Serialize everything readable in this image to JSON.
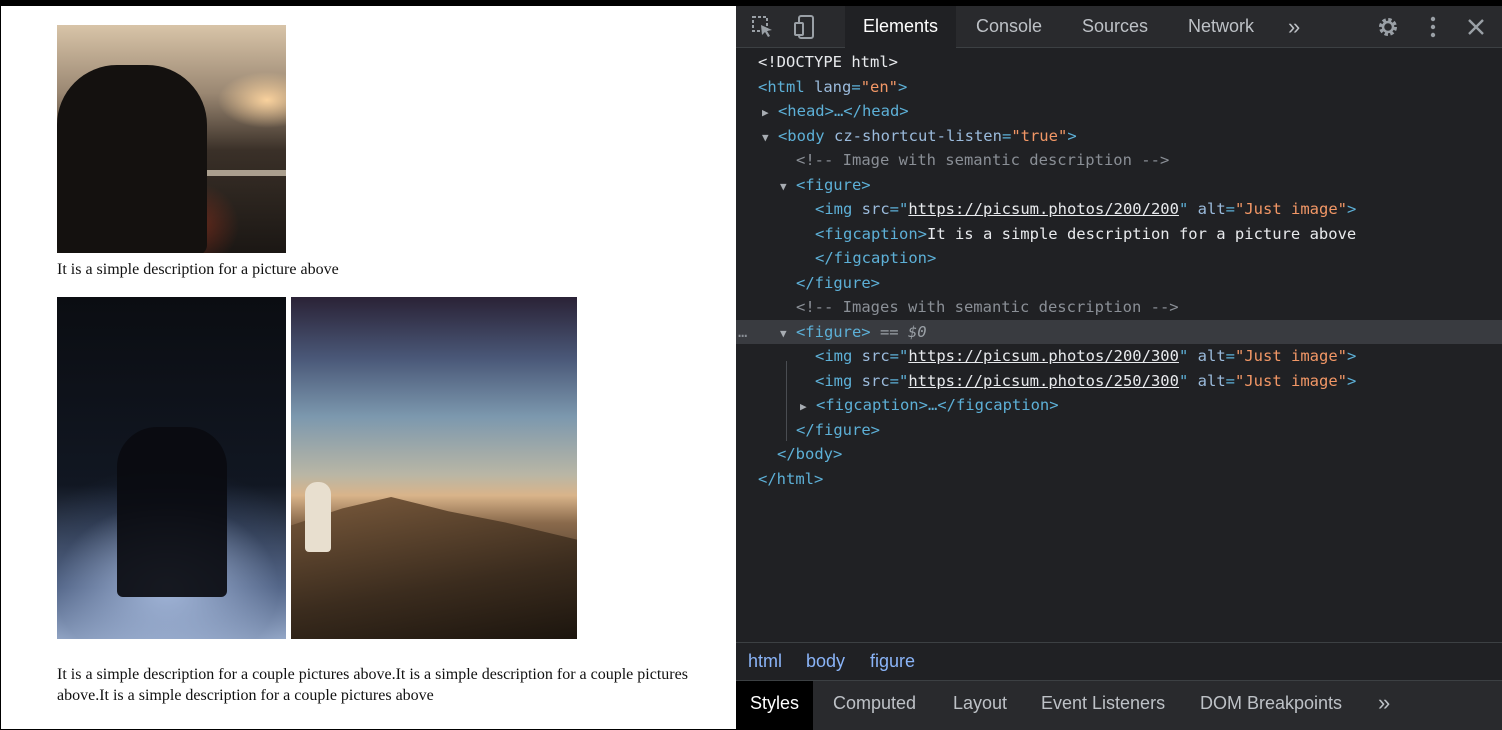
{
  "page": {
    "caption1": "It is a simple description for a picture above",
    "caption2": "It is a simple description for a couple pictures above.It is a simple description for a couple pictures above.It is a simple description for a couple pictures above"
  },
  "devtools": {
    "toolbar": {
      "inspect_icon": "inspect-element-icon",
      "device_icon": "device-toolbar-icon",
      "tabs": [
        "Elements",
        "Console",
        "Sources",
        "Network"
      ],
      "more_tabs": "»",
      "settings_icon": "gear-icon",
      "menu_icon": "kebab-menu-icon",
      "close_icon": "close-icon"
    },
    "dom": {
      "doctype": "<!DOCTYPE html>",
      "html_open": "<html",
      "html_attr": "lang",
      "html_val": "\"en\"",
      "head": "<head>…</head>",
      "body_open": "<body",
      "body_attr": "cz-shortcut-listen",
      "body_val": "\"true\"",
      "comment1": "<!-- Image with semantic description -->",
      "figure_open": "<figure>",
      "img_open": "<img",
      "src_attr": "src",
      "alt_attr": "alt",
      "alt_val": "\"Just image\"",
      "img1_src": "https://picsum.photos/200/200",
      "figcaption_open": "<figcaption>",
      "figcaption_text": "It is a simple description for a picture above",
      "figcaption_close": "</figcaption>",
      "figure_close": "</figure>",
      "comment2": "<!-- Images with semantic description -->",
      "selected_marker": "== $0",
      "img2_src": "https://picsum.photos/200/300",
      "img3_src": "https://picsum.photos/250/300",
      "figcaption_collapsed": "<figcaption>…</figcaption>",
      "body_close": "</body>",
      "html_close": "</html>",
      "ellipsis": "…"
    },
    "breadcrumb": [
      "html",
      "body",
      "figure"
    ],
    "panel_tabs": [
      "Styles",
      "Computed",
      "Layout",
      "Event Listeners",
      "DOM Breakpoints"
    ],
    "panel_more": "»"
  }
}
